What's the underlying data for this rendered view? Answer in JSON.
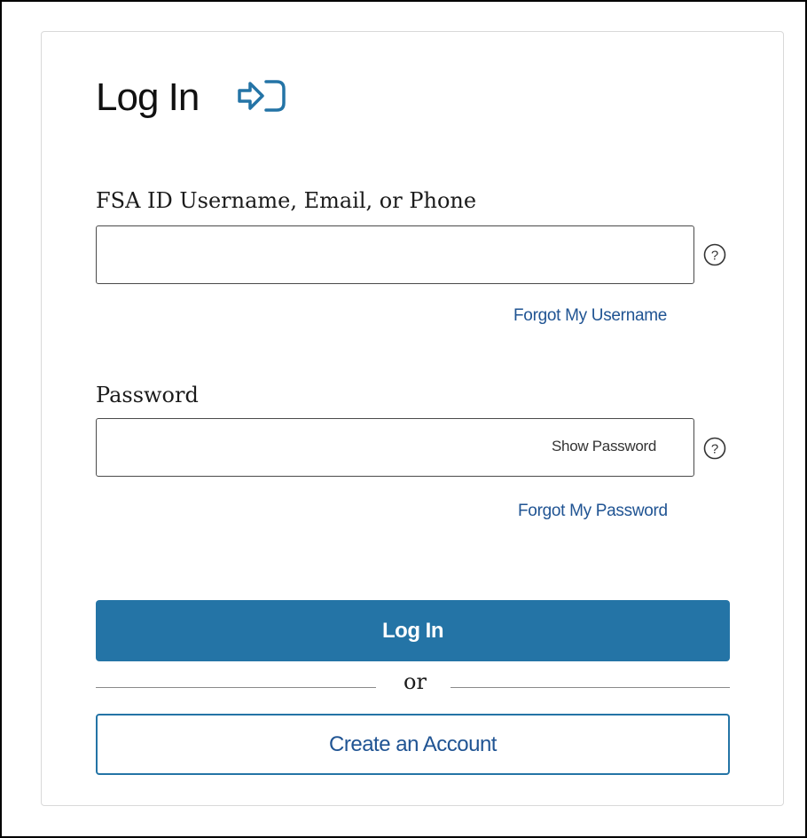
{
  "login": {
    "title": "Log In",
    "username_label": "FSA ID Username, Email, or Phone",
    "username_value": "",
    "forgot_username": "Forgot My Username",
    "password_label": "Password",
    "password_value": "",
    "show_password": "Show Password",
    "forgot_password": "Forgot My Password",
    "login_button": "Log In",
    "or_text": "or",
    "create_account": "Create an Account"
  },
  "icons": {
    "login": "login-arrow-icon",
    "help": "question-circle-icon"
  },
  "colors": {
    "primary": "#2474a6",
    "link": "#205493",
    "border": "#4a4a4a"
  }
}
